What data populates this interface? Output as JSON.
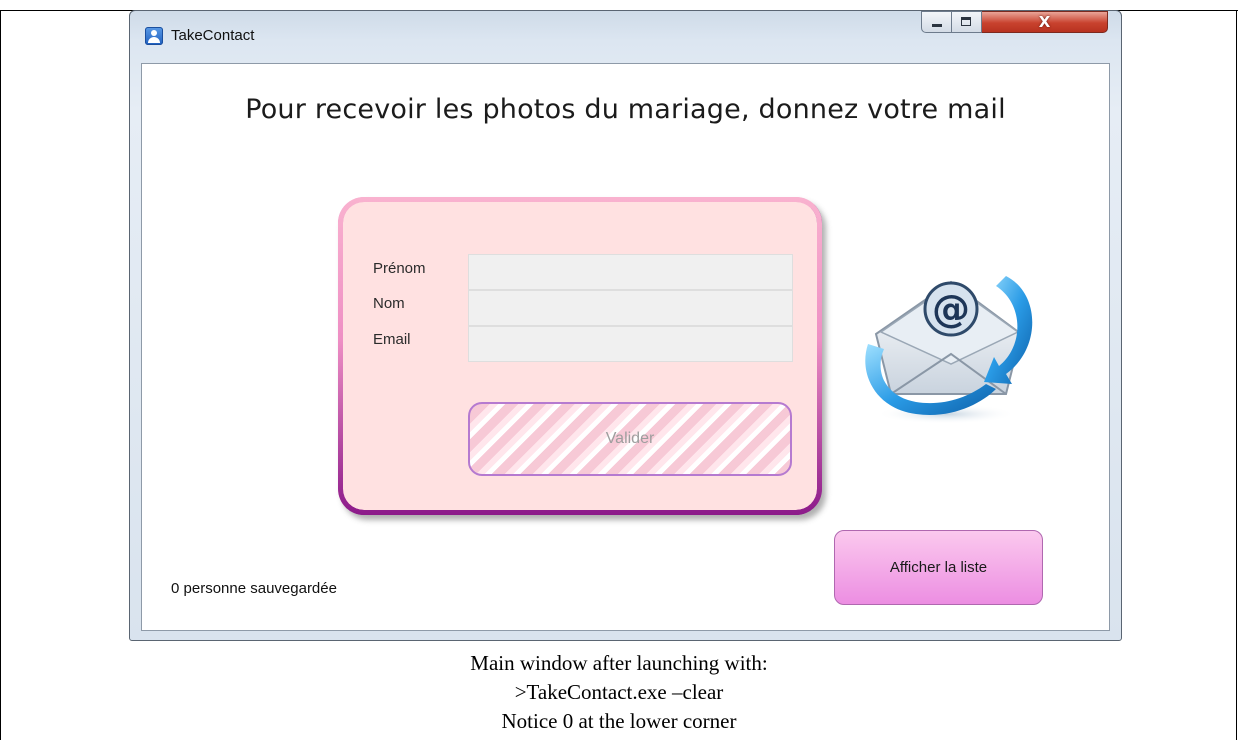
{
  "window": {
    "title": "TakeContact",
    "controls": {
      "minimize": "minimize-icon",
      "maximize": "maximize-icon",
      "close_label": "X"
    }
  },
  "main": {
    "heading": "Pour recevoir les photos du mariage, donnez votre mail",
    "form": {
      "firstname_label": "Prénom",
      "lastname_label": "Nom",
      "email_label": "Email",
      "firstname_value": "",
      "lastname_value": "",
      "email_value": "",
      "submit_label": "Valider"
    },
    "status": "0 personne sauvegardée",
    "list_button_label": "Afficher la liste",
    "illustration_icon": "email-at-envelope-icon"
  },
  "caption": {
    "line1": "Main window after launching with:",
    "line2": ">TakeContact.exe –clear",
    "line3": "Notice 0 at the lower corner"
  },
  "colors": {
    "card_background": "#ffe1e1",
    "card_border_top": "#f7a8cc",
    "card_border_bottom": "#7e0c7e",
    "list_button": "#ec8ee2",
    "close_button": "#c8422e"
  }
}
